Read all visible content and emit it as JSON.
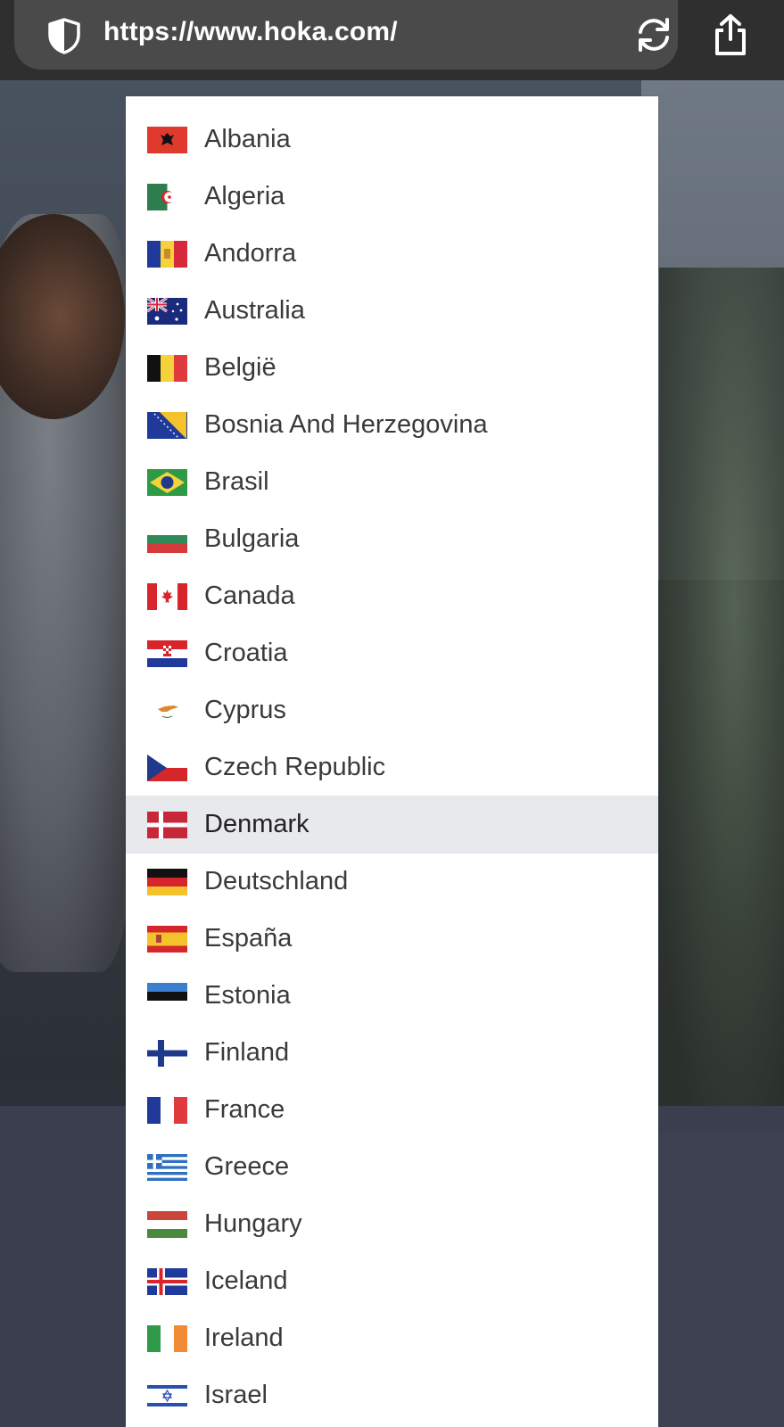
{
  "browser": {
    "url": "https://www.hoka.com/",
    "shield_icon": "shield-icon",
    "reload_icon": "reload-icon",
    "share_icon": "share-icon"
  },
  "country_list": {
    "selected_index": 12,
    "items": [
      {
        "label": "Albania",
        "flag": "albania-flag-icon"
      },
      {
        "label": "Algeria",
        "flag": "algeria-flag-icon"
      },
      {
        "label": "Andorra",
        "flag": "andorra-flag-icon"
      },
      {
        "label": "Australia",
        "flag": "australia-flag-icon"
      },
      {
        "label": "België",
        "flag": "belgium-flag-icon"
      },
      {
        "label": "Bosnia And Herzegovina",
        "flag": "bosnia-flag-icon"
      },
      {
        "label": "Brasil",
        "flag": "brazil-flag-icon"
      },
      {
        "label": "Bulgaria",
        "flag": "bulgaria-flag-icon"
      },
      {
        "label": "Canada",
        "flag": "canada-flag-icon"
      },
      {
        "label": "Croatia",
        "flag": "croatia-flag-icon"
      },
      {
        "label": "Cyprus",
        "flag": "cyprus-flag-icon"
      },
      {
        "label": "Czech Republic",
        "flag": "czech-flag-icon"
      },
      {
        "label": "Denmark",
        "flag": "denmark-flag-icon"
      },
      {
        "label": "Deutschland",
        "flag": "germany-flag-icon"
      },
      {
        "label": "España",
        "flag": "spain-flag-icon"
      },
      {
        "label": "Estonia",
        "flag": "estonia-flag-icon"
      },
      {
        "label": "Finland",
        "flag": "finland-flag-icon"
      },
      {
        "label": "France",
        "flag": "france-flag-icon"
      },
      {
        "label": "Greece",
        "flag": "greece-flag-icon"
      },
      {
        "label": "Hungary",
        "flag": "hungary-flag-icon"
      },
      {
        "label": "Iceland",
        "flag": "iceland-flag-icon"
      },
      {
        "label": "Ireland",
        "flag": "ireland-flag-icon"
      },
      {
        "label": "Israel",
        "flag": "israel-flag-icon"
      }
    ]
  },
  "colors": {
    "selected_row_bg": "#e8e9ec",
    "address_bar_bg": "#2f2f2f"
  }
}
